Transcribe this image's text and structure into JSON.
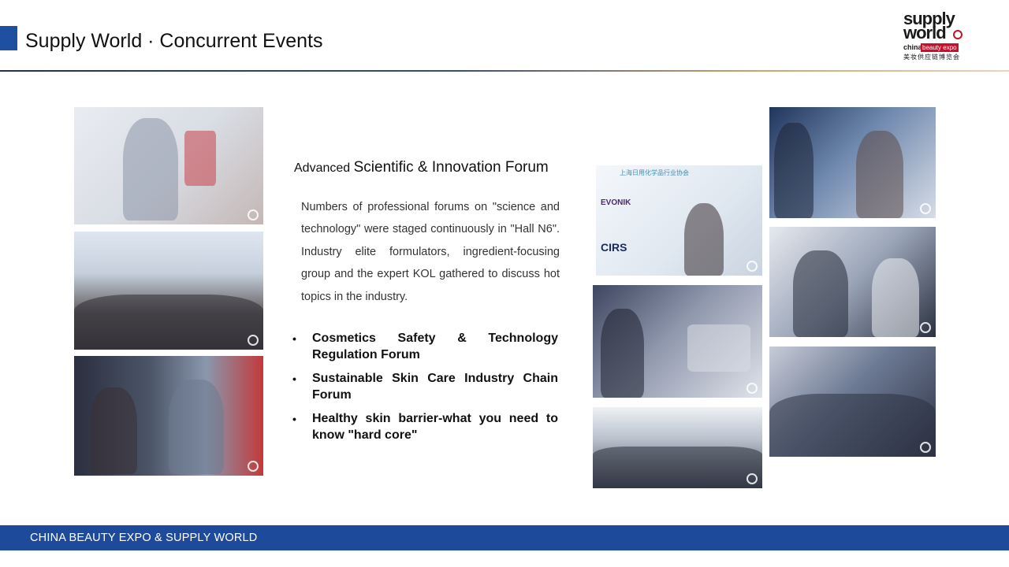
{
  "header": {
    "title": "Supply World · Concurrent Events",
    "accent_color": "#1f4fa0"
  },
  "logo": {
    "line1": "supply",
    "line2": "world",
    "china": "china",
    "beauty_expo": "beauty expo",
    "chinese": "美妆供应链博览会"
  },
  "photos": {
    "stage_slide_org": "上海日用化学品行业协会",
    "stage_slide_brand1": "EVONIK",
    "stage_slide_brand2": "CIRS"
  },
  "section": {
    "heading_small": "Advanced",
    "heading_big": "Scientific & Innovation Forum",
    "description": "Numbers of professional forums on \"science and technology\" were staged continuously in \"Hall N6\". Industry elite formulators, ingredient-focusing group and the expert KOL gathered to discuss hot topics in the industry.",
    "bullets": [
      "Cosmetics Safety  & Technology Regulation Forum",
      "Sustainable Skin Care Industry Chain Forum",
      "Healthy skin barrier-what you need to know \"hard core\""
    ]
  },
  "footer": {
    "text": "CHINA BEAUTY EXPO & SUPPLY  WORLD",
    "color": "#1e4a9c"
  }
}
